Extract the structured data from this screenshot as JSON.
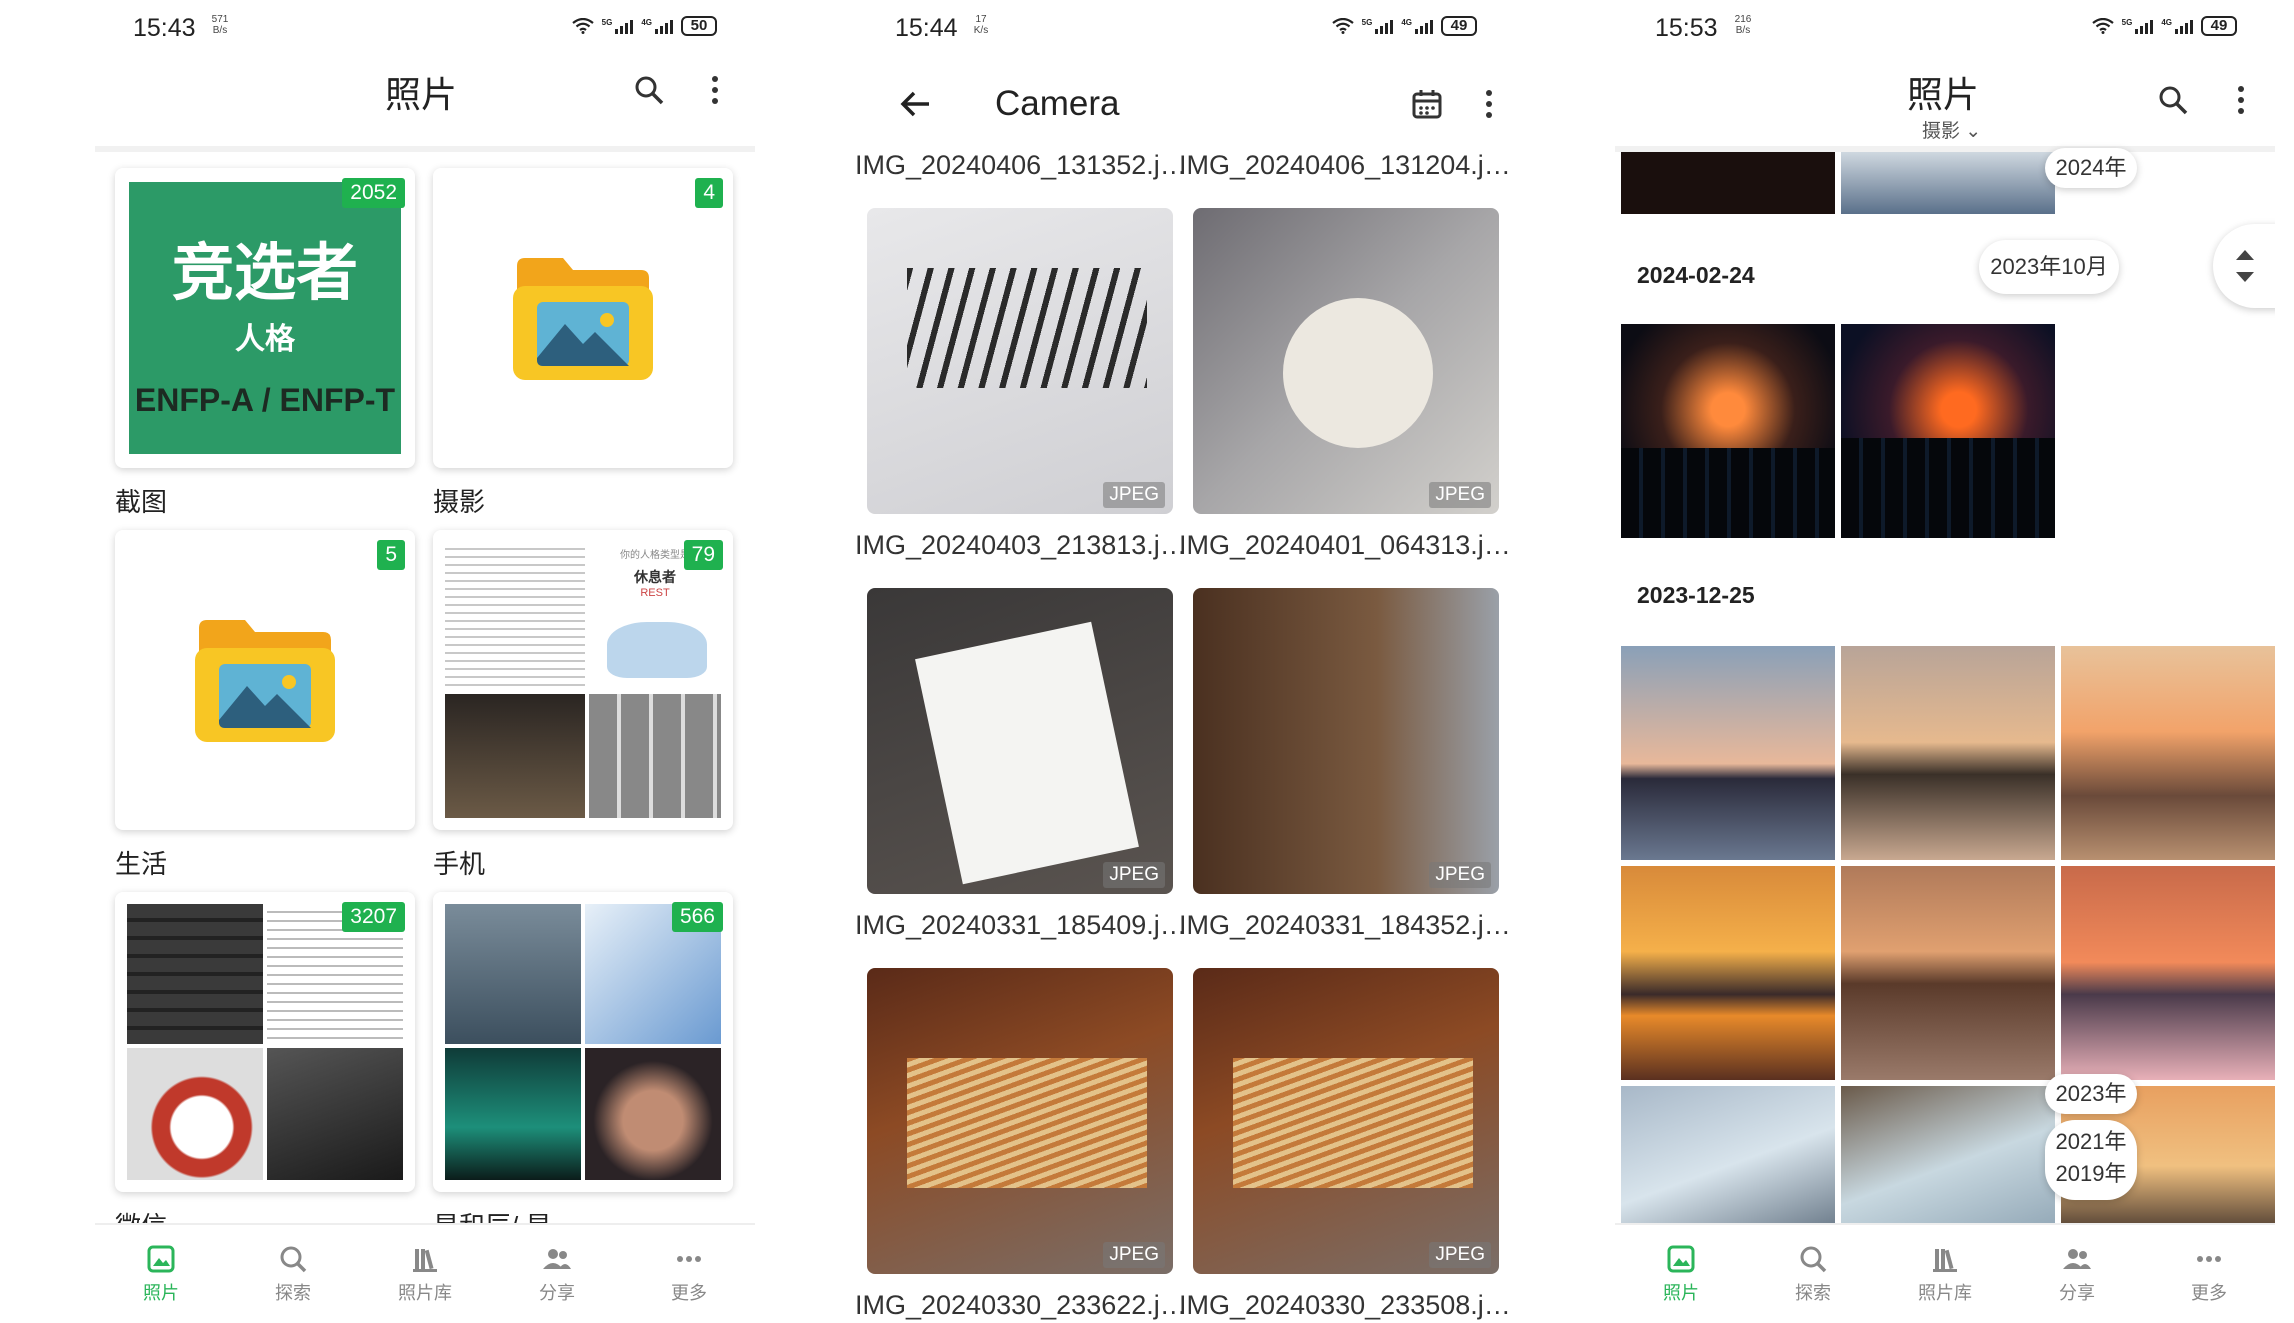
{
  "screen1": {
    "time": "15:43",
    "speed": "571 B/s",
    "battery": "50",
    "title": "照片",
    "albums": [
      {
        "name": "截图",
        "count": "2052",
        "cover": {
          "title": "竞选者",
          "subtitle": "人格",
          "footer": "ENFP-A / ENFP-T"
        }
      },
      {
        "name": "摄影",
        "count": "4"
      },
      {
        "name": "生活",
        "count": "5"
      },
      {
        "name": "手机",
        "count": "79",
        "cover": {
          "header": "你的人格类型是",
          "title": "休息者",
          "subtitle": "REST"
        }
      },
      {
        "name": "微信",
        "count": "3207"
      },
      {
        "name": "星和辰/ 星",
        "count": "566"
      }
    ]
  },
  "screen2": {
    "time": "15:44",
    "speed": "17 K/s",
    "battery": "49",
    "title": "Camera",
    "top_names": [
      "IMG_20240406_131352.j…",
      "IMG_20240406_131204.j…"
    ],
    "rows": [
      {
        "left": "IMG_20240403_213813.j…",
        "right": "IMG_20240401_064313.j…"
      },
      {
        "left": "IMG_20240331_185409.j…",
        "right": "IMG_20240331_184352.j…"
      },
      {
        "left": "IMG_20240330_233622.j…",
        "right": "IMG_20240330_233508.j…"
      }
    ],
    "type_label": "JPEG"
  },
  "screen3": {
    "time": "15:53",
    "speed": "216 B/s",
    "battery": "49",
    "title": "照片",
    "subtitle": "摄影",
    "dates": [
      "2024-02-24",
      "2023-12-25"
    ],
    "year_pill_top": "2024年",
    "month_pill": "2023年10月",
    "year_pills": [
      "2023年",
      "2021年",
      "2019年"
    ]
  },
  "nav": [
    "照片",
    "探索",
    "照片库",
    "分享",
    "更多"
  ],
  "colors": {
    "accent": "#2bb55a",
    "badge": "#1fb14f"
  }
}
